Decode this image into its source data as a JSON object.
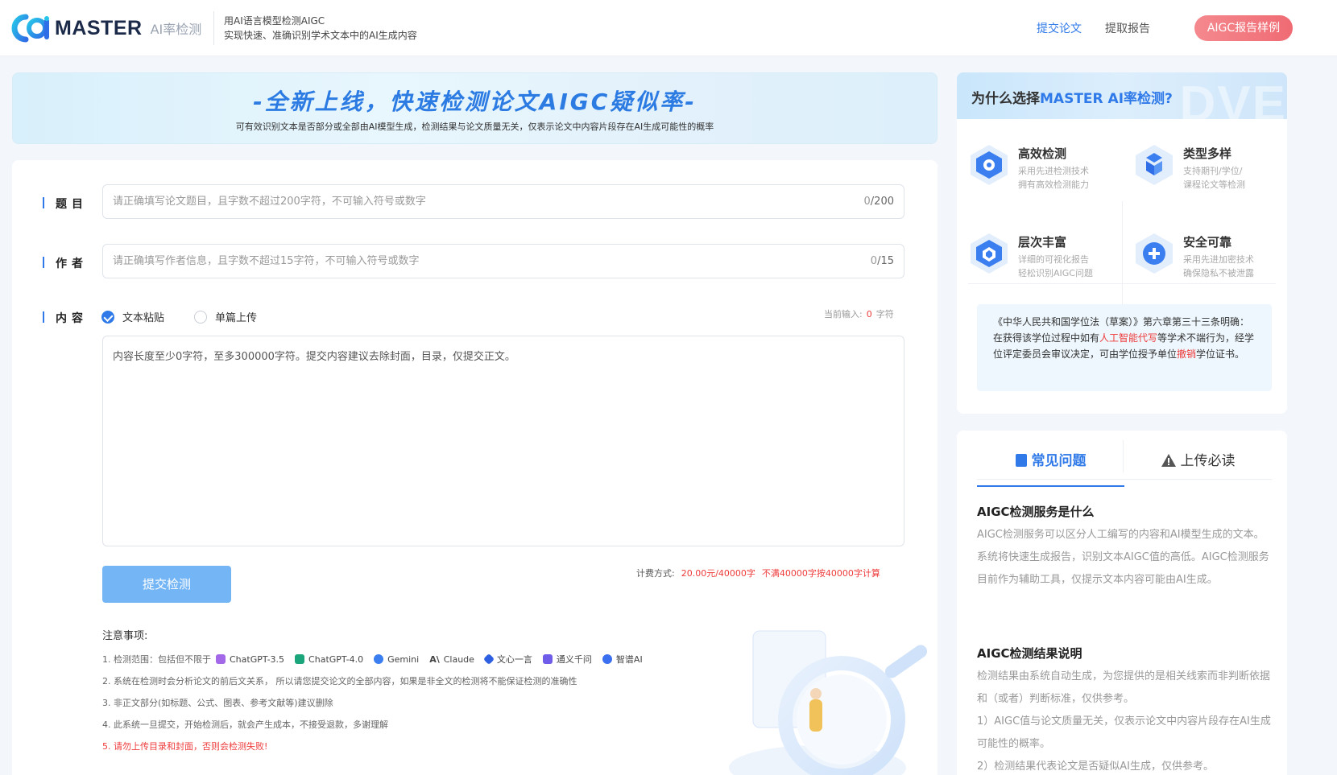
{
  "header": {
    "brand": "MASTER",
    "brand_sub": "AI率检测",
    "slogan_line1": "用AI语言模型检测AIGC",
    "slogan_line2": "实现快速、准确识别学术文本中的AI生成内容",
    "nav": [
      {
        "label": "提交论文",
        "active": true
      },
      {
        "label": "提取报告",
        "active": false
      }
    ],
    "sample_button": "AIGC报告样例"
  },
  "banner": {
    "title": "-全新上线，快速检测论文AIGC疑似率-",
    "desc": "可有效识别文本是否部分或全部由AI模型生成，检测结果与论文质量无关，仅表示论文中内容片段存在AI生成可能性的概率"
  },
  "form": {
    "title_label": "题目",
    "title_placeholder": "请正确填写论文题目，且字数不超过200字符，不可输入符号或数字",
    "title_count": "0",
    "title_max": "/200",
    "author_label": "作者",
    "author_placeholder": "请正确填写作者信息，且字数不超过15字符，不可输入符号或数字",
    "author_count": "0",
    "author_max": "/15",
    "content_label": "内容",
    "mode_paste": "文本粘贴",
    "mode_upload": "单篇上传",
    "current_input_label": "当前输入:",
    "current_input_value": "0",
    "current_input_unit": "字符",
    "content_placeholder": "内容长度至少0字符，至多300000字符。提交内容建议去除封面，目录，仅提交正文。",
    "submit_button": "提交检测",
    "pricing_label": "计费方式:",
    "pricing_price": "20.00元/40000字",
    "pricing_note": "不满40000字按40000字计算"
  },
  "notes": {
    "title": "注意事项:",
    "item1_prefix": "1. 检测范围：包括但不限于",
    "models": [
      "ChatGPT-3.5",
      "ChatGPT-4.0",
      "Gemini",
      "Claude",
      "文心一言",
      "通义千问",
      "智谱AI"
    ],
    "item2": "2. 系统在检测时会分析论文的前后文关系， 所以请您提交论文的全部内容，如果是非全文的检测将不能保证检测的准确性",
    "item3": "3. 非正文部分(如标题、公式、图表、参考文献等)建议删除",
    "item4": "4. 此系统一旦提交，开始检测后，就会产生成本，不接受退款，多谢理解",
    "item5": "5. 请勿上传目录和封面，否则会检测失败!"
  },
  "why": {
    "title_prefix": "为什么选择",
    "title_highlight": "MASTER AI率检测?",
    "bg_text": "DVE",
    "features": [
      {
        "name": "高效检测",
        "desc1": "采用先进检测技术",
        "desc2": "拥有高效检测能力"
      },
      {
        "name": "类型多样",
        "desc1": "支持期刊/学位/",
        "desc2": "课程论文等检测"
      },
      {
        "name": "层次丰富",
        "desc1": "详细的可视化报告",
        "desc2": "轻松识别AIGC问题"
      },
      {
        "name": "安全可靠",
        "desc1": "采用先进加密技术",
        "desc2": "确保隐私不被泄露"
      }
    ],
    "law_part1": "《中华人民共和国学位法（草案）》第六章第三十三条明确：在获得该学位过程中如有",
    "law_red1": "人工智能代写",
    "law_part2": "等学术不端行为，经学位评定委员会审议决定，可由学位授予单位",
    "law_red2": "撤销",
    "law_part3": "学位证书。"
  },
  "faq": {
    "tab_faq": "常见问题",
    "tab_read": "上传必读",
    "q1": "AIGC检测服务是什么",
    "a1": "AIGC检测服务可以区分人工编写的内容和AI模型生成的文本。 系统将快速生成报告，识别文本AIGC值的高低。AIGC检测服务目前作为辅助工具，仅提示文本内容可能由AI生成。",
    "q2": "AIGC检测结果说明",
    "a2_1": "检测结果由系统自动生成，为您提供的是相关线索而非判断依据和（或者）判断标准，仅供参考。",
    "a2_2": "1）AIGC值与论文质量无关，仅表示论文中内容片段存在AI生成可能性的概率。",
    "a2_3": "2）检测结果代表论文是否疑似AI生成，仅供参考。"
  },
  "colors": {
    "accent": "#2f7ae8",
    "danger": "#ee3b3b",
    "button": "#73b5f5",
    "sample": "#f06b74"
  }
}
